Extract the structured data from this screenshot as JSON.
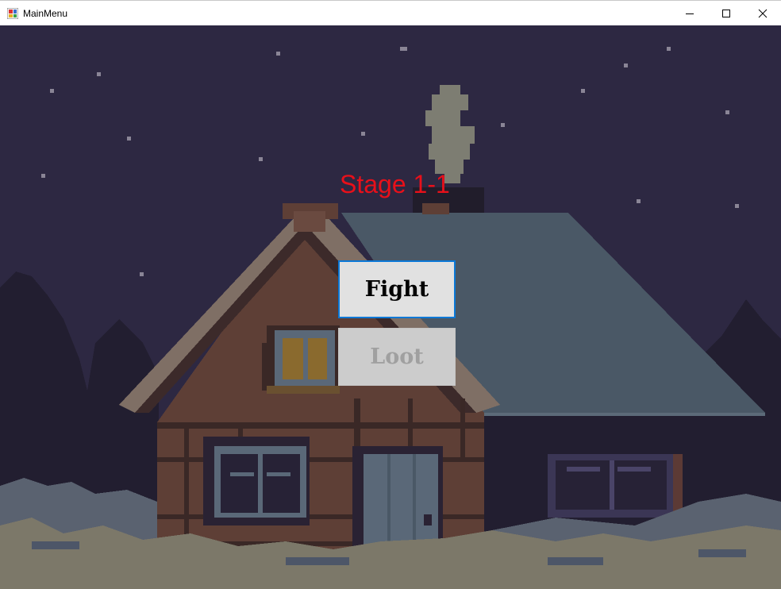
{
  "window": {
    "title": "MainMenu",
    "controls": [
      "minimize",
      "maximize",
      "close"
    ]
  },
  "stage": {
    "label": "Stage 1-1",
    "color": "#e8101a"
  },
  "buttons": {
    "fight": {
      "label": "Fight",
      "enabled": true,
      "focused": true
    },
    "loot": {
      "label": "Loot",
      "enabled": false
    }
  },
  "scene": {
    "description_icon": "snowy-cabin-night-icon",
    "colors": {
      "sky": "#2d2842",
      "trees": "#211d2e",
      "roof": "#4a5866",
      "brick": "#5e3f36",
      "snow": "#7c7869",
      "accent_focus": "#0b78d7"
    }
  }
}
